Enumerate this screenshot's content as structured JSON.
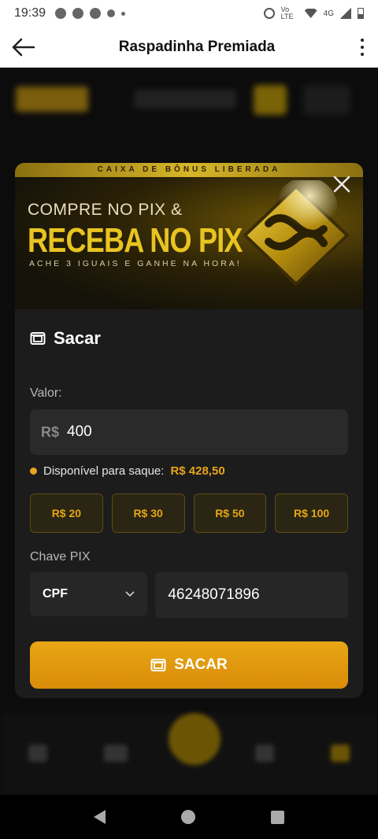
{
  "status_bar": {
    "time": "19:39",
    "network": "Vo LTE",
    "network2": "4G"
  },
  "app_bar": {
    "title": "Raspadinha Premiada"
  },
  "banner": {
    "strip": "CAIXA DE BÔNUS LIBERADA",
    "line1": "COMPRE NO PIX &",
    "line2": "RECEBA NO PIX",
    "line3": "ACHE 3 IGUAIS E GANHE NA HORA!"
  },
  "withdraw": {
    "title": "Sacar",
    "amount_label": "Valor:",
    "currency": "R$",
    "amount_value": "400",
    "available_label": "Disponível para saque:",
    "available_amount": "R$ 428,50",
    "quick_amounts": [
      "R$ 20",
      "R$ 30",
      "R$ 50",
      "R$ 100"
    ],
    "pix_label": "Chave PIX",
    "key_type": "CPF",
    "pix_key": "46248071896",
    "submit_label": "SACAR"
  },
  "colors": {
    "accent": "#e8a41a",
    "banner_gold": "#e8c422",
    "modal_bg": "#1c1c1c"
  }
}
